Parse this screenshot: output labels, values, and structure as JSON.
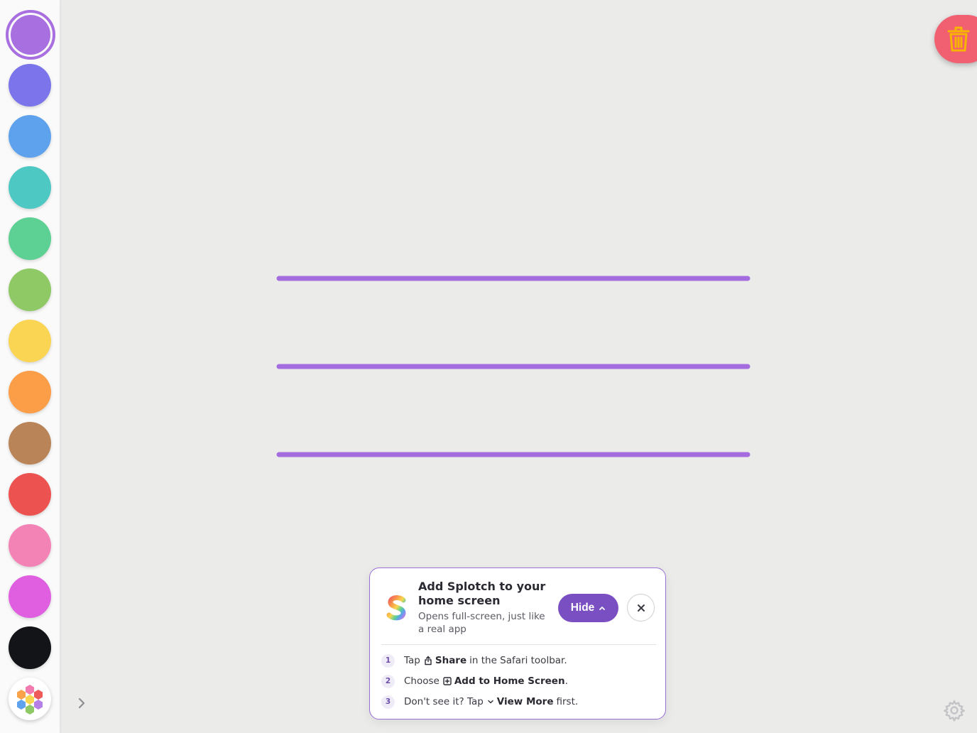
{
  "palette": {
    "selected_index": 0,
    "colors": [
      "#a86fe0",
      "#7b74ea",
      "#5ea2ee",
      "#4ec8c2",
      "#5dd193",
      "#8ec965",
      "#fad553",
      "#fc9d47",
      "#b88458",
      "#ec5350",
      "#f483b5",
      "#e05fe0",
      "#121418"
    ]
  },
  "accent_color": "#7a4fc2",
  "trash_color": "#f06070",
  "trash_icon_color": "#f7b500",
  "canvas": {
    "stroke_color": "#a56ce0",
    "stroke_count": 3
  },
  "install_prompt": {
    "title": "Add Splotch to your home screen",
    "subtitle": "Opens full-screen, just like a real app",
    "hide_label": "Hide",
    "steps": [
      {
        "num": "1",
        "pre": "Tap",
        "icon": "share-icon",
        "bold": "Share",
        "post": "in the Safari toolbar."
      },
      {
        "num": "2",
        "pre": "Choose",
        "icon": "add-square-icon",
        "bold": "Add to Home Screen",
        "post": "."
      },
      {
        "num": "3",
        "pre": "Don't see it? Tap",
        "icon": "chevron-down-icon",
        "bold": "View More",
        "post": "first."
      }
    ]
  },
  "icons": {
    "custom_color": "color-wheel-icon",
    "expand": "chevron-right-icon",
    "trash": "trash-icon",
    "settings": "gear-icon"
  }
}
